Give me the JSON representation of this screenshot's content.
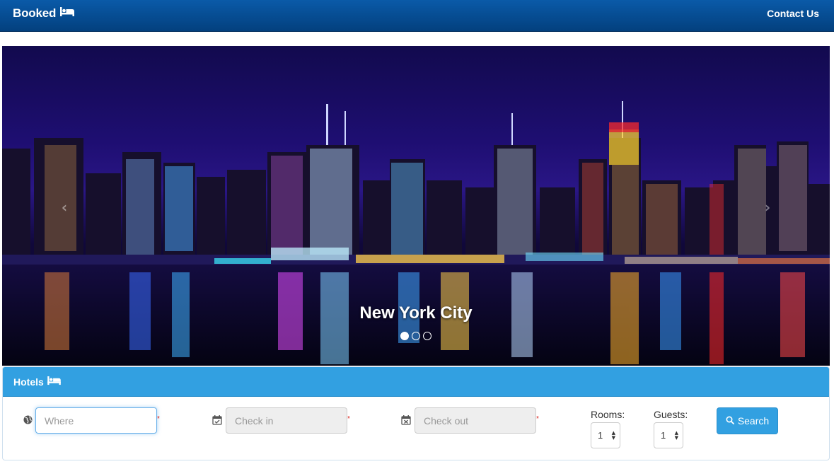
{
  "navbar": {
    "brand": "Booked",
    "brand_icon": "bed-icon",
    "contact_label": "Contact Us"
  },
  "carousel": {
    "caption": "New York City",
    "slide_count": 3,
    "active_index": 0,
    "prev_glyph": "‹",
    "next_glyph": "›"
  },
  "search_panel": {
    "title": "Hotels",
    "title_icon": "bed-icon",
    "where": {
      "placeholder": "Where",
      "icon": "globe-icon",
      "required_mark": "*"
    },
    "check_in": {
      "placeholder": "Check in",
      "icon": "calendar-check-icon",
      "required_mark": "*"
    },
    "check_out": {
      "placeholder": "Check out",
      "icon": "calendar-x-icon",
      "required_mark": "*"
    },
    "rooms": {
      "label": "Rooms:",
      "value": "1"
    },
    "guests": {
      "label": "Guests:",
      "value": "1"
    },
    "search_button": {
      "label": "Search",
      "icon": "search-icon"
    }
  },
  "colors": {
    "navbar": "#03407e",
    "panel_heading": "#32a0e1",
    "button": "#32a0e1",
    "required": "#d9231d"
  }
}
